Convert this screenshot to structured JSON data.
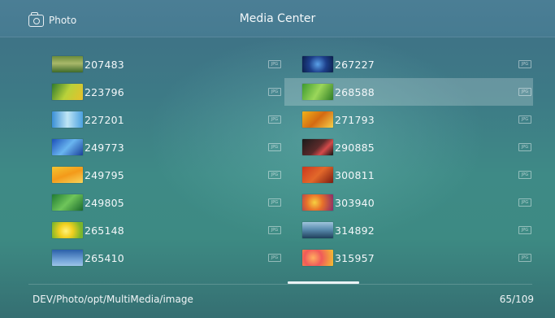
{
  "header": {
    "app_label": "Photo",
    "title": "Media Center"
  },
  "files": {
    "left": [
      {
        "name": "207483",
        "type": "JPG"
      },
      {
        "name": "223796",
        "type": "JPG"
      },
      {
        "name": "227201",
        "type": "JPG"
      },
      {
        "name": "249773",
        "type": "JPG"
      },
      {
        "name": "249795",
        "type": "JPG"
      },
      {
        "name": "249805",
        "type": "JPG"
      },
      {
        "name": "265148",
        "type": "JPG"
      },
      {
        "name": "265410",
        "type": "JPG"
      }
    ],
    "right": [
      {
        "name": "267227",
        "type": "JPG"
      },
      {
        "name": "268588",
        "type": "JPG",
        "selected": true
      },
      {
        "name": "271793",
        "type": "JPG"
      },
      {
        "name": "290885",
        "type": "JPG"
      },
      {
        "name": "300811",
        "type": "JPG"
      },
      {
        "name": "303940",
        "type": "JPG"
      },
      {
        "name": "314892",
        "type": "JPG"
      },
      {
        "name": "315957",
        "type": "JPG"
      }
    ]
  },
  "footer": {
    "path": "DEV/Photo/opt/MultiMedia/image",
    "count": "65/109"
  },
  "colors": {
    "selection": "#ffffff38",
    "text": "#f3f7f9"
  }
}
